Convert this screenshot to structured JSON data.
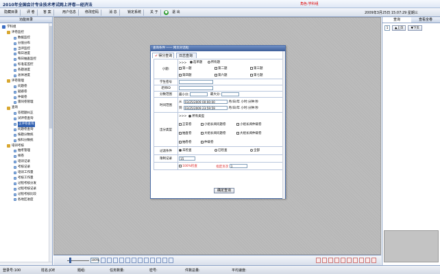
{
  "app": {
    "title": "2010年全国会计专业技术考试网上评卷—经济法",
    "role": "角色:学科组",
    "datetime": "2009年3月25日 15:07:29 星期三"
  },
  "menu": {
    "items": [
      "隐藏目录",
      "评 卷",
      "答 案",
      "用户信息",
      "修改密码",
      "消 息",
      "锁定系统",
      "关 于"
    ],
    "exit_label": "退 出"
  },
  "left_panel": {
    "header": "功能目录",
    "tree": [
      {
        "label": "学科组",
        "level": 0,
        "type": "root"
      },
      {
        "label": "评卷监控",
        "level": 1,
        "type": "cat"
      },
      {
        "label": "数据监控",
        "level": 2
      },
      {
        "label": "分值分布",
        "level": 2
      },
      {
        "label": "当评监控",
        "level": 2
      },
      {
        "label": "每日进度",
        "level": 2
      },
      {
        "label": "每日抽查监控",
        "level": 2
      },
      {
        "label": "标准差监控",
        "level": 2
      },
      {
        "label": "各题进度",
        "level": 2
      },
      {
        "label": "总体进度",
        "level": 2
      },
      {
        "label": "评卷管理",
        "level": 1,
        "type": "cat"
      },
      {
        "label": "问题卷",
        "level": 2
      },
      {
        "label": "疑惑卷",
        "level": 2
      },
      {
        "label": "仲裁卷",
        "level": 2
      },
      {
        "label": "雷同卷管理",
        "level": 2
      },
      {
        "label": "查询",
        "level": 1,
        "type": "cat"
      },
      {
        "label": "答错题纠正",
        "level": 2
      },
      {
        "label": "试评卷查询",
        "level": 2
      },
      {
        "label": "正评卷查询",
        "level": 2,
        "selected": true
      },
      {
        "label": "问题卷查询",
        "level": 2
      },
      {
        "label": "按题分数统",
        "level": 2
      },
      {
        "label": "按科分数统",
        "level": 2
      },
      {
        "label": "培训考核",
        "level": 1,
        "type": "cat"
      },
      {
        "label": "抽考管理",
        "level": 2
      },
      {
        "label": "样卷",
        "level": 2
      },
      {
        "label": "培训记录",
        "level": 2
      },
      {
        "label": "考核记录",
        "level": 2
      },
      {
        "label": "培训工作量",
        "level": 2
      },
      {
        "label": "考核工作量",
        "level": 2
      },
      {
        "label": "过程考核分发",
        "level": 2
      },
      {
        "label": "过程考核记录",
        "level": 2
      },
      {
        "label": "过程考核比较",
        "level": 2
      },
      {
        "label": "各地区进度",
        "level": 2
      }
    ]
  },
  "dialog": {
    "title": "查询条件 —— 网页对话框",
    "tabs": {
      "score_query": "得分查询",
      "log_query": "日志查询"
    },
    "question": {
      "label": "小题:",
      "prefix": ">>>",
      "mode": [
        "选单题",
        "所有题"
      ],
      "items": [
        "第一题",
        "第二题",
        "第三题",
        "第四题",
        "第六题",
        "第七题"
      ]
    },
    "student_no": {
      "label": "学生密号",
      "value": ""
    },
    "teacher_id": {
      "label": "老师ID",
      "value": ""
    },
    "score_range": {
      "label": "分数范围",
      "min_label": "最小分:",
      "max_label": "最大分:"
    },
    "time_range": {
      "label": "时间范围",
      "from_label": "从",
      "to_label": "到",
      "from_value": "03/25/2009 00:00:00",
      "to_value": "03/25/2009 23:59:59",
      "format_hint": "月/日/年 小时:分钟:秒"
    },
    "paper_type": {
      "label": "出分类型",
      "prefix": ">>>",
      "all_label": "所有类型",
      "options": [
        "正常卷",
        "小组长阅问题卷",
        "小组长阅仲裁卷",
        "抽查卷",
        "大组长阅问题卷",
        "大组长阅仲裁卷",
        "抽卷卷",
        "仲裁卷"
      ]
    },
    "filter": {
      "label": "过滤条件",
      "options": [
        "未检查",
        "已检查",
        "全部"
      ]
    },
    "limit": {
      "label": "限制记录",
      "value": "15"
    },
    "check_all": {
      "label": "100%检查",
      "times_label": "指定页次",
      "times_value": "1"
    },
    "submit_label": "确定查询"
  },
  "right_panel": {
    "tabs": [
      "查询",
      "查看全卷"
    ],
    "page_value": "1",
    "prev_label": "上页",
    "next_label": "下页"
  },
  "toolbar": {
    "zoom": "100%"
  },
  "status": {
    "login_count": "登录号:100",
    "name": "姓名:JOE",
    "group": "题组:",
    "task_count": "任务数量:",
    "password": "密号:",
    "paper_count": "件数总量:",
    "avg_speed": "平均速度:"
  }
}
